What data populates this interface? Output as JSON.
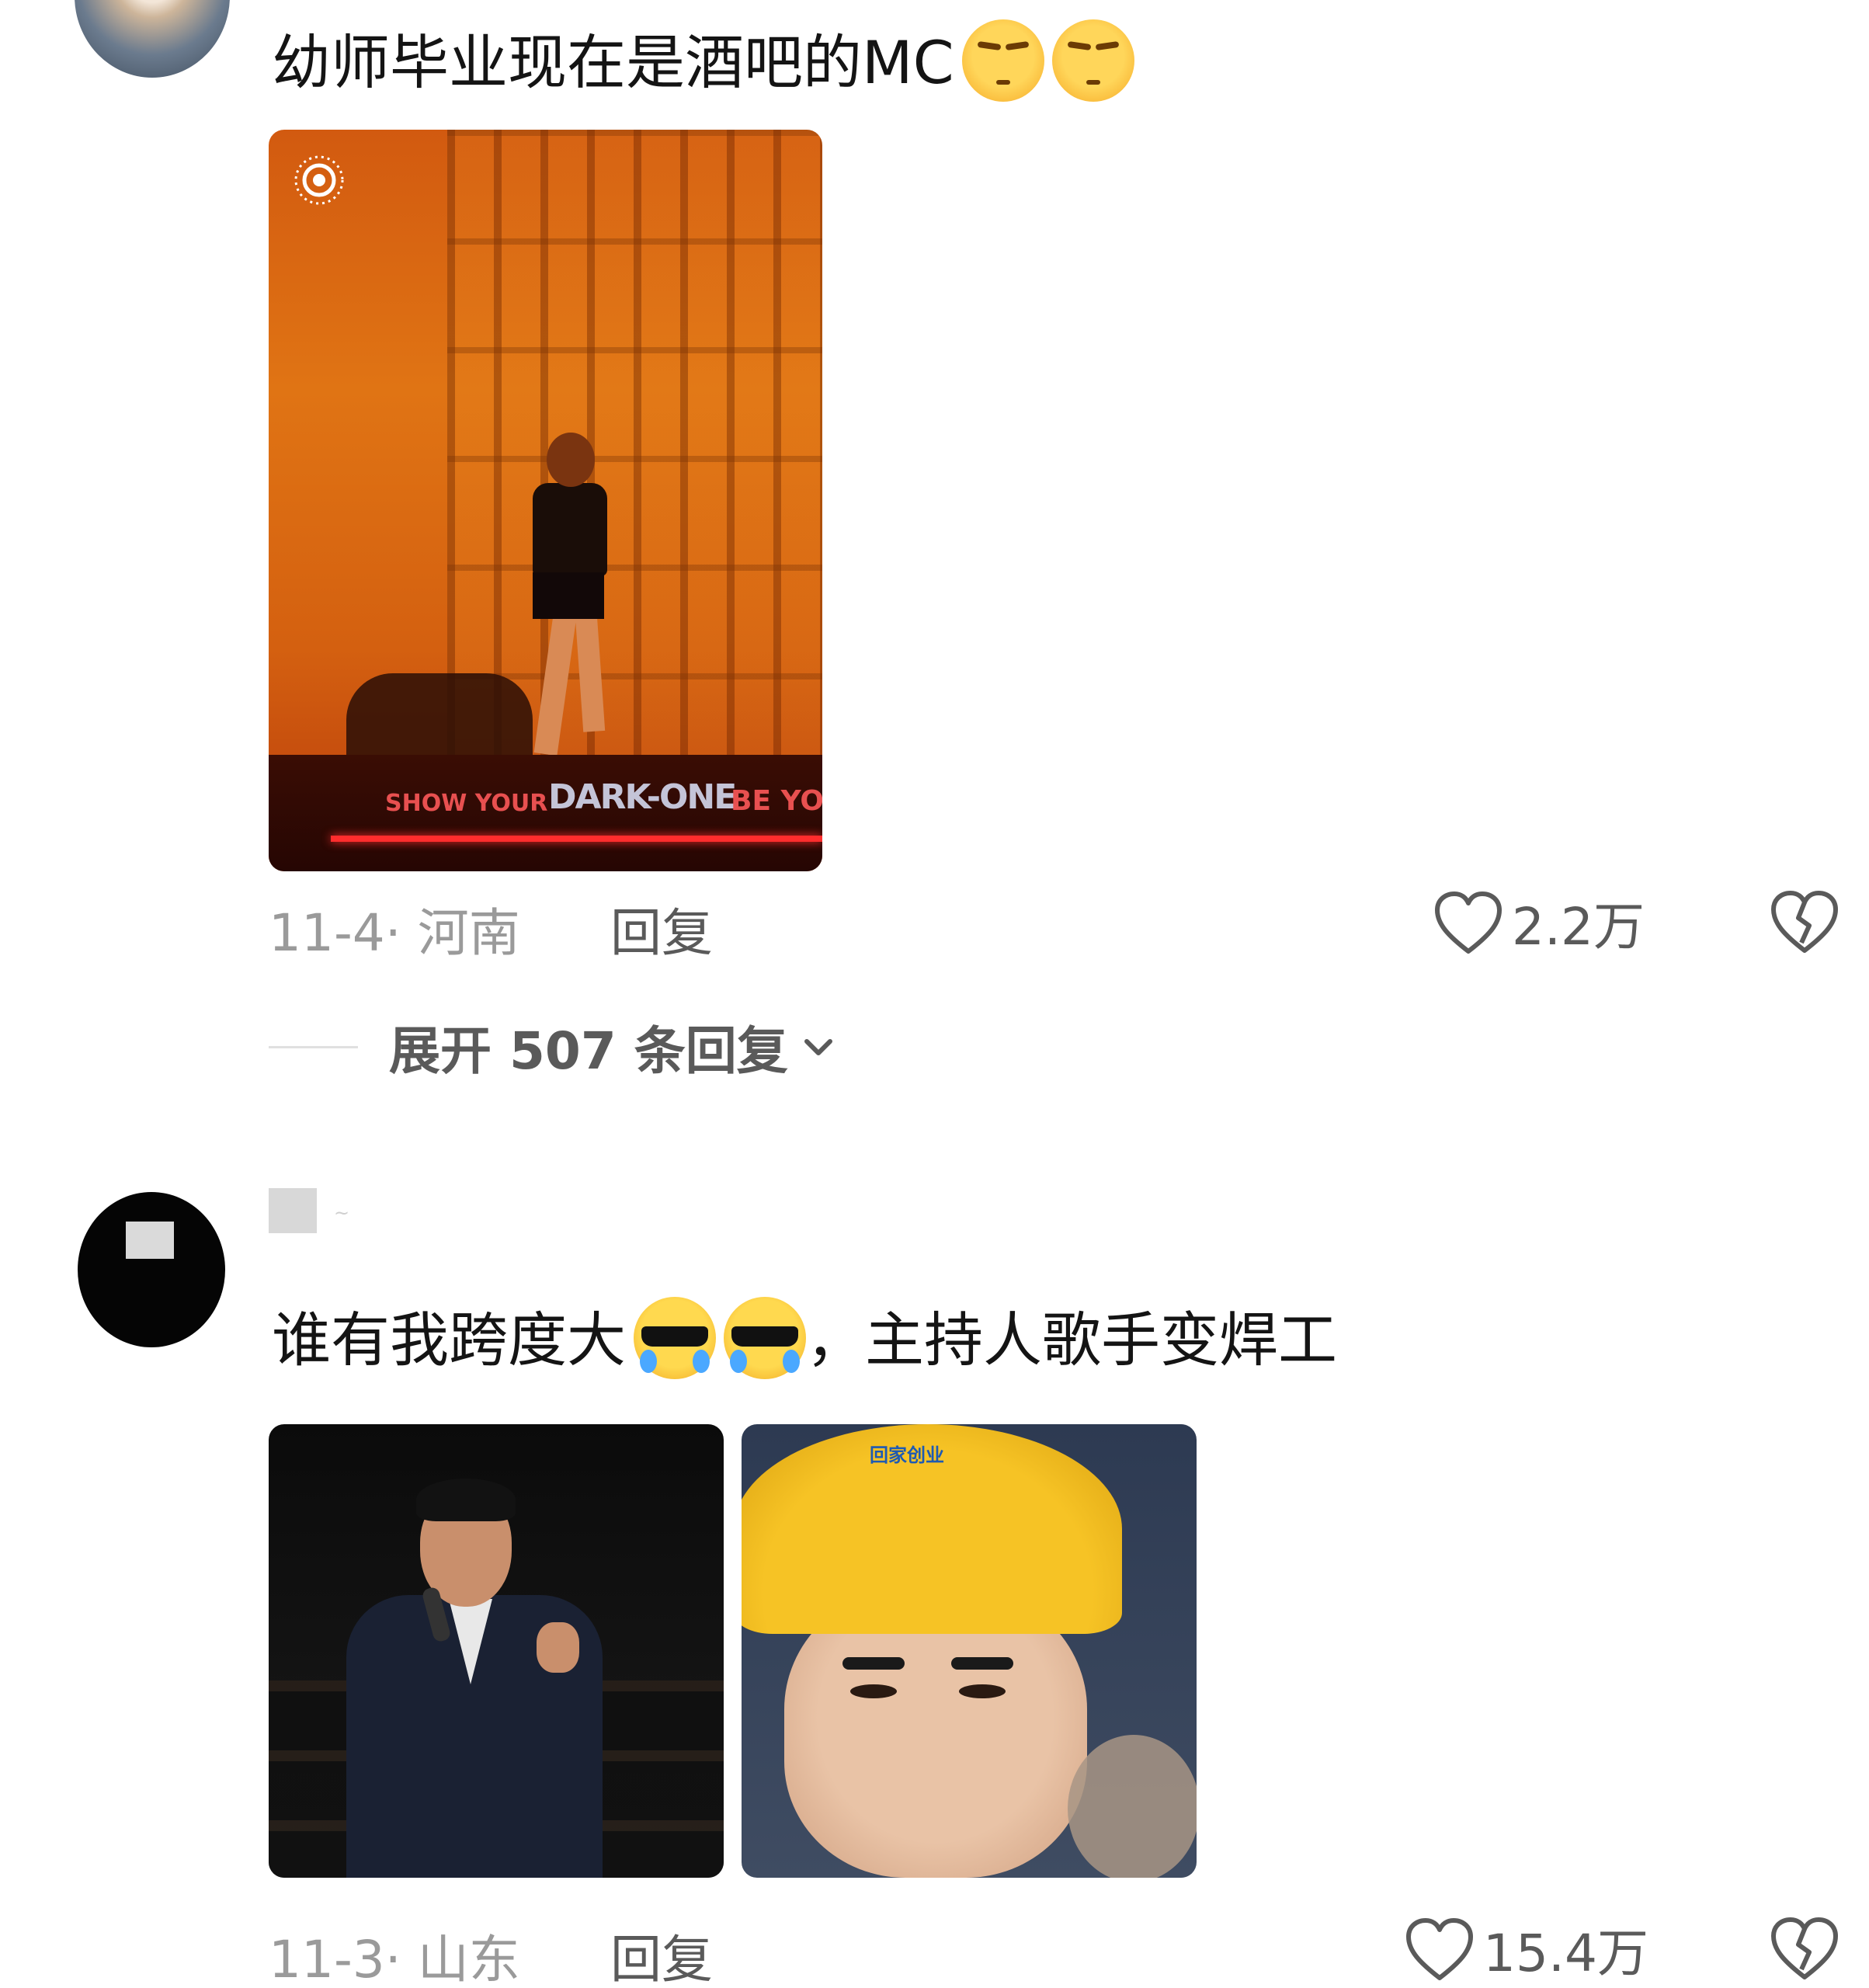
{
  "comments": [
    {
      "text": "幼师毕业现在是酒吧的MC",
      "emojis": [
        "frown-emoji",
        "frown-emoji"
      ],
      "image": {
        "stage_text_left": "SHOW YOUR",
        "stage_text_center": "DARK-ONE",
        "stage_text_right": "BE YOU"
      },
      "date": "11-4",
      "location": "河南",
      "reply_label": "回复",
      "likes": "2.2万",
      "expand_label": "展开 507 条回复"
    },
    {
      "username": "~",
      "text_before": "谁有我跨度大",
      "emojis": [
        "cool-crying-emoji",
        "cool-crying-emoji"
      ],
      "text_after": "，主持人歌手变焊工",
      "images": [
        {
          "helmet_text": ""
        },
        {
          "helmet_text": "回家创业"
        }
      ],
      "date": "11-3",
      "location": "山东",
      "reply_label": "回复",
      "likes": "15.4万"
    }
  ],
  "colors": {
    "text_primary": "#141414",
    "text_meta": "#9a9a9a",
    "text_action": "#5a5a5a",
    "emoji_yellow": "#ffd65a"
  }
}
